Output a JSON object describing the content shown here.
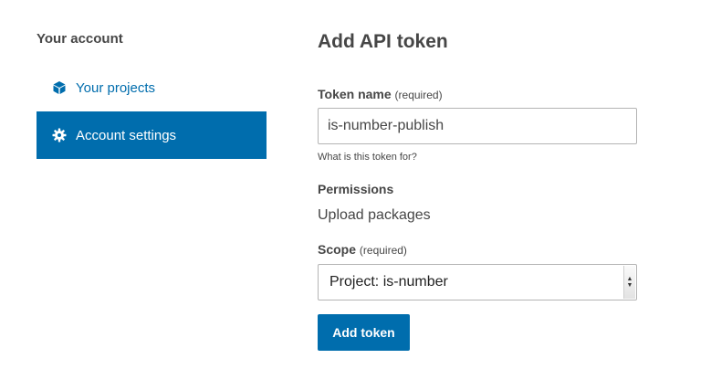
{
  "sidebar": {
    "heading": "Your account",
    "items": [
      {
        "label": "Your projects",
        "icon": "cube-icon",
        "active": false
      },
      {
        "label": "Account settings",
        "icon": "gear-icon",
        "active": true
      }
    ]
  },
  "main": {
    "title": "Add API token",
    "token_name": {
      "label": "Token name",
      "required_note": "(required)",
      "value": "is-number-publish",
      "help": "What is this token for?"
    },
    "permissions": {
      "label": "Permissions",
      "value": "Upload packages"
    },
    "scope": {
      "label": "Scope",
      "required_note": "(required)",
      "selected": "Project: is-number"
    },
    "submit_label": "Add token"
  },
  "colors": {
    "brand_blue": "#006dad",
    "text": "#464646",
    "border": "#b4b4b4"
  }
}
